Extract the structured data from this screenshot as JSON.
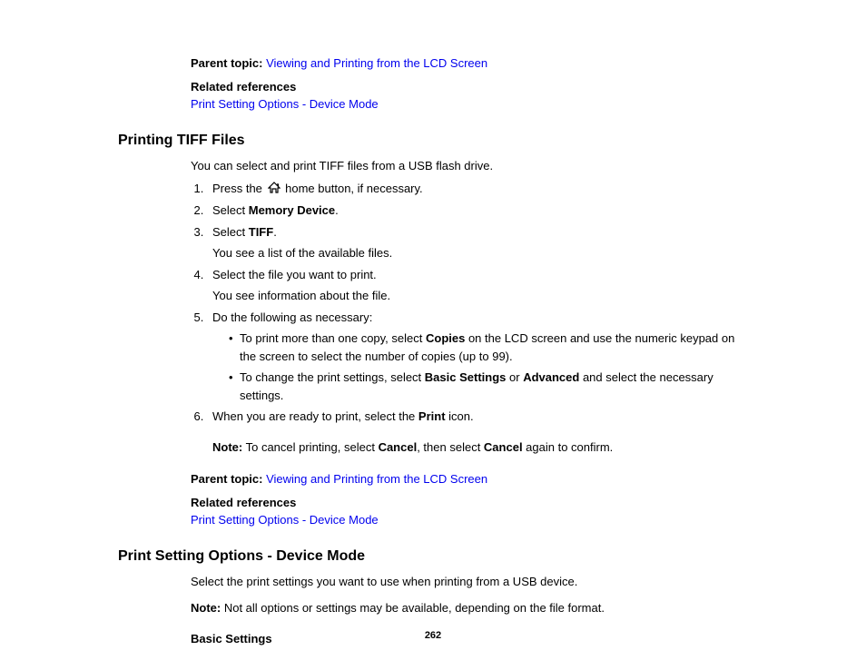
{
  "top": {
    "parent_topic_label": "Parent topic:",
    "parent_topic_link": "Viewing and Printing from the LCD Screen",
    "related_refs_label": "Related references",
    "related_link": "Print Setting Options - Device Mode"
  },
  "section1": {
    "heading": "Printing TIFF Files",
    "intro": "You can select and print TIFF files from a USB flash drive.",
    "step1_pre": "Press the ",
    "step1_post": " home button, if necessary.",
    "step2_pre": "Select ",
    "step2_bold": "Memory Device",
    "step2_post": ".",
    "step3_pre": "Select ",
    "step3_bold": "TIFF",
    "step3_post": ".",
    "step3_sub": "You see a list of the available files.",
    "step4": "Select the file you want to print.",
    "step4_sub": "You see information about the file.",
    "step5": "Do the following as necessary:",
    "bullet1_pre": "To print more than one copy, select ",
    "bullet1_bold": "Copies",
    "bullet1_post": " on the LCD screen and use the numeric keypad on the screen to select the number of copies (up to 99).",
    "bullet2_pre": "To change the print settings, select ",
    "bullet2_bold1": "Basic Settings",
    "bullet2_mid": " or ",
    "bullet2_bold2": "Advanced",
    "bullet2_post": " and select the necessary settings.",
    "step6_pre": "When you are ready to print, select the ",
    "step6_bold": "Print",
    "step6_post": " icon.",
    "note_label": "Note:",
    "note_pre": " To cancel printing, select ",
    "note_bold1": "Cancel",
    "note_mid": ", then select ",
    "note_bold2": "Cancel",
    "note_post": " again to confirm.",
    "parent_topic_label": "Parent topic:",
    "parent_topic_link": "Viewing and Printing from the LCD Screen",
    "related_refs_label": "Related references",
    "related_link": "Print Setting Options - Device Mode"
  },
  "section2": {
    "heading": "Print Setting Options - Device Mode",
    "intro": "Select the print settings you want to use when printing from a USB device.",
    "note_label": "Note:",
    "note_text": " Not all options or settings may be available, depending on the file format.",
    "basic_settings": "Basic Settings"
  },
  "page_number": "262"
}
